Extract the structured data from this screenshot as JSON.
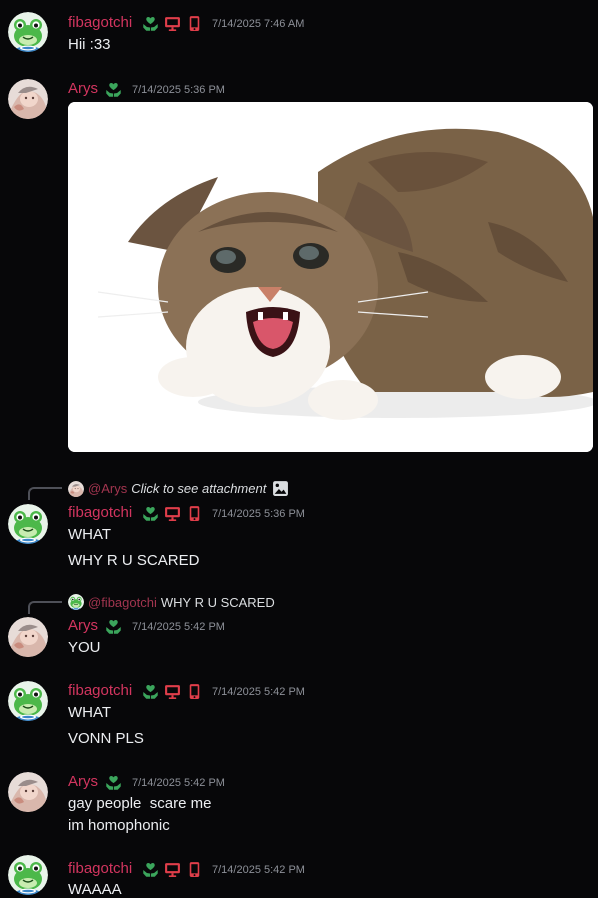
{
  "colors": {
    "background": "#070709",
    "username": "#d2355f",
    "timestamp": "#8d9098",
    "text": "#eceef1",
    "badge_green": "#3ba55c",
    "badge_red": "#e03e4a"
  },
  "users": {
    "fibagotchi": {
      "name": "fibagotchi",
      "badges": [
        "heart-hands-badge-icon",
        "desktop-icon",
        "mobile-icon"
      ]
    },
    "arys": {
      "name": "Arys",
      "badges": [
        "heart-hands-badge-icon"
      ]
    }
  },
  "messages": [
    {
      "author": "fibagotchi",
      "timestamp": "7/14/2025 7:46 AM",
      "lines": [
        "Hii :33"
      ]
    },
    {
      "author": "Arys",
      "timestamp": "7/14/2025 5:36 PM",
      "attachment": "kitten-image"
    },
    {
      "author": "fibagotchi",
      "timestamp": "7/14/2025 5:36 PM",
      "reply": {
        "mention": "@Arys",
        "text": "Click to see attachment"
      },
      "lines": [
        "WHAT",
        "WHY R U SCARED"
      ]
    },
    {
      "author": "Arys",
      "timestamp": "7/14/2025 5:42 PM",
      "reply": {
        "mention": "@fibagotchi",
        "text": "WHY R U SCARED"
      },
      "lines": [
        "YOU"
      ]
    },
    {
      "author": "fibagotchi",
      "timestamp": "7/14/2025 5:42 PM",
      "lines": [
        "WHAT",
        "VONN PLS"
      ]
    },
    {
      "author": "Arys",
      "timestamp": "7/14/2025 5:42 PM",
      "lines": [
        "gay people  scare me",
        "im homophonic"
      ]
    },
    {
      "author": "fibagotchi",
      "timestamp": "7/14/2025 5:42 PM",
      "lines": [
        "WAAAA"
      ]
    }
  ]
}
